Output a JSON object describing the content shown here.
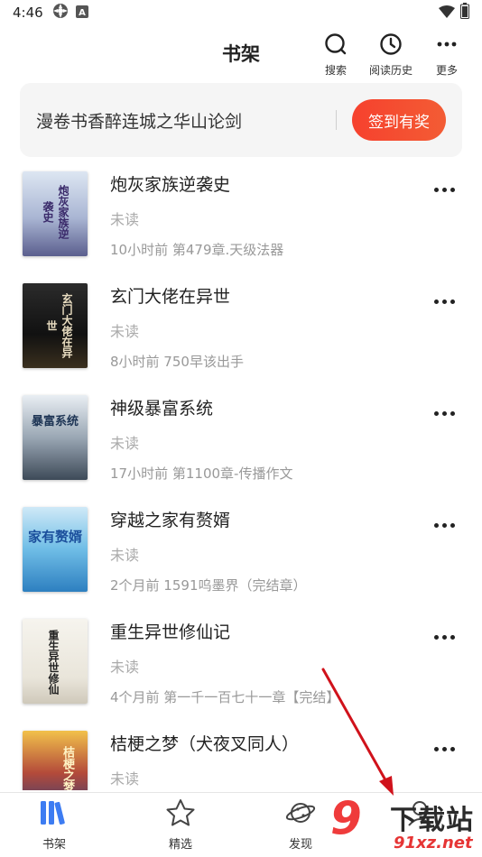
{
  "status_bar": {
    "time": "4:46",
    "icons": [
      "settings-wheel-icon",
      "font-a-icon",
      "wifi-icon",
      "battery-icon"
    ]
  },
  "header": {
    "title": "书架",
    "actions": [
      {
        "label": "搜索",
        "icon": "search-icon"
      },
      {
        "label": "阅读历史",
        "icon": "clock-icon"
      },
      {
        "label": "更多",
        "icon": "more-icon"
      }
    ]
  },
  "banner": {
    "text": "漫卷书香醉连城之华山论剑",
    "button_label": "签到有奖",
    "button_color": "#f6412e"
  },
  "books": [
    {
      "title": "炮灰家族逆袭史",
      "status": "未读",
      "progress": "10小时前 第479章.天级法器",
      "cover_text": "炮灰家族逆袭史"
    },
    {
      "title": "玄门大佬在异世",
      "status": "未读",
      "progress": "8小时前 750早该出手",
      "cover_text": "玄门大佬在异世"
    },
    {
      "title": "神级暴富系统",
      "status": "未读",
      "progress": "17小时前 第1100章-传播作文",
      "cover_text": "暴富系统"
    },
    {
      "title": "穿越之家有赘婿",
      "status": "未读",
      "progress": "2个月前 1591呜墨界（完结章）",
      "cover_text": "家有赘婿"
    },
    {
      "title": "重生异世修仙记",
      "status": "未读",
      "progress": "4个月前 第一千一百七十一章【完结】",
      "cover_text": "重生异世修仙"
    },
    {
      "title": "桔梗之梦（犬夜叉同人）",
      "status": "未读",
      "progress": "",
      "cover_text": "桔梗之梦"
    }
  ],
  "bottom_nav": [
    {
      "label": "书架",
      "icon": "bookshelf-icon",
      "active": true
    },
    {
      "label": "精选",
      "icon": "star-icon",
      "active": false
    },
    {
      "label": "发现",
      "icon": "planet-icon",
      "active": false
    },
    {
      "label": "",
      "icon": "user-icon",
      "active": false
    }
  ],
  "watermark": {
    "logo_text": "9",
    "brand": "下载站",
    "url": "91xz.net"
  },
  "colors": {
    "accent": "#f6412e",
    "active_nav": "#3d7cf2",
    "arrow": "#d0121b"
  }
}
